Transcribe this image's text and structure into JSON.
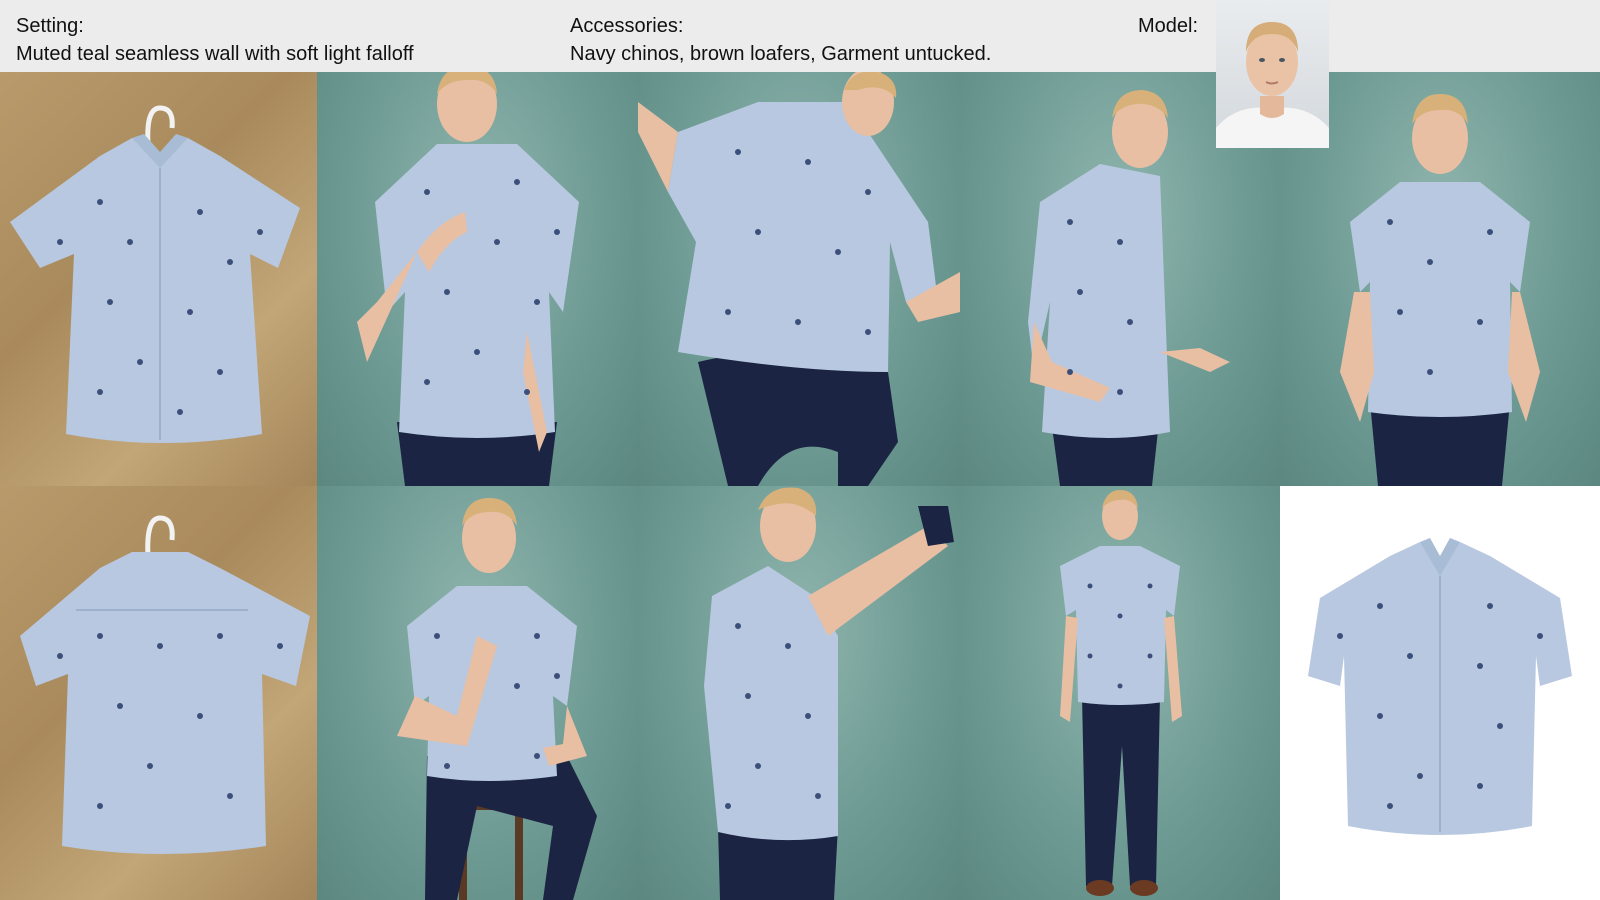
{
  "header": {
    "setting_label": "Setting:",
    "setting_value": "Muted teal seamless wall with soft light falloff",
    "accessories_label": "Accessories:",
    "accessories_value": "Navy chinos, brown loafers, Garment untucked.",
    "model_label": "Model:"
  },
  "colors": {
    "background_teal": "#6e9b94",
    "floor_tan": "#b89a6b",
    "shirt_blue": "#b7c8e0",
    "print_navy": "#3c4f7a",
    "chinos_navy": "#1c2444",
    "loafers_brown": "#6b3a22",
    "skin": "#e8bfa3",
    "hair": "#d8b07a"
  },
  "panels": [
    {
      "row": 1,
      "content": "shirt-flat-front"
    },
    {
      "row": 1,
      "content": "model-front-hand-at-collar"
    },
    {
      "row": 1,
      "content": "model-back-bending"
    },
    {
      "row": 1,
      "content": "model-side-walking"
    },
    {
      "row": 1,
      "content": "model-front-standing"
    },
    {
      "row": 2,
      "content": "shirt-flat-back"
    },
    {
      "row": 2,
      "content": "model-seated-on-stool"
    },
    {
      "row": 2,
      "content": "model-side-arms-raised"
    },
    {
      "row": 2,
      "content": "model-full-length"
    },
    {
      "row": 2,
      "content": "shirt-packshot-white"
    }
  ]
}
